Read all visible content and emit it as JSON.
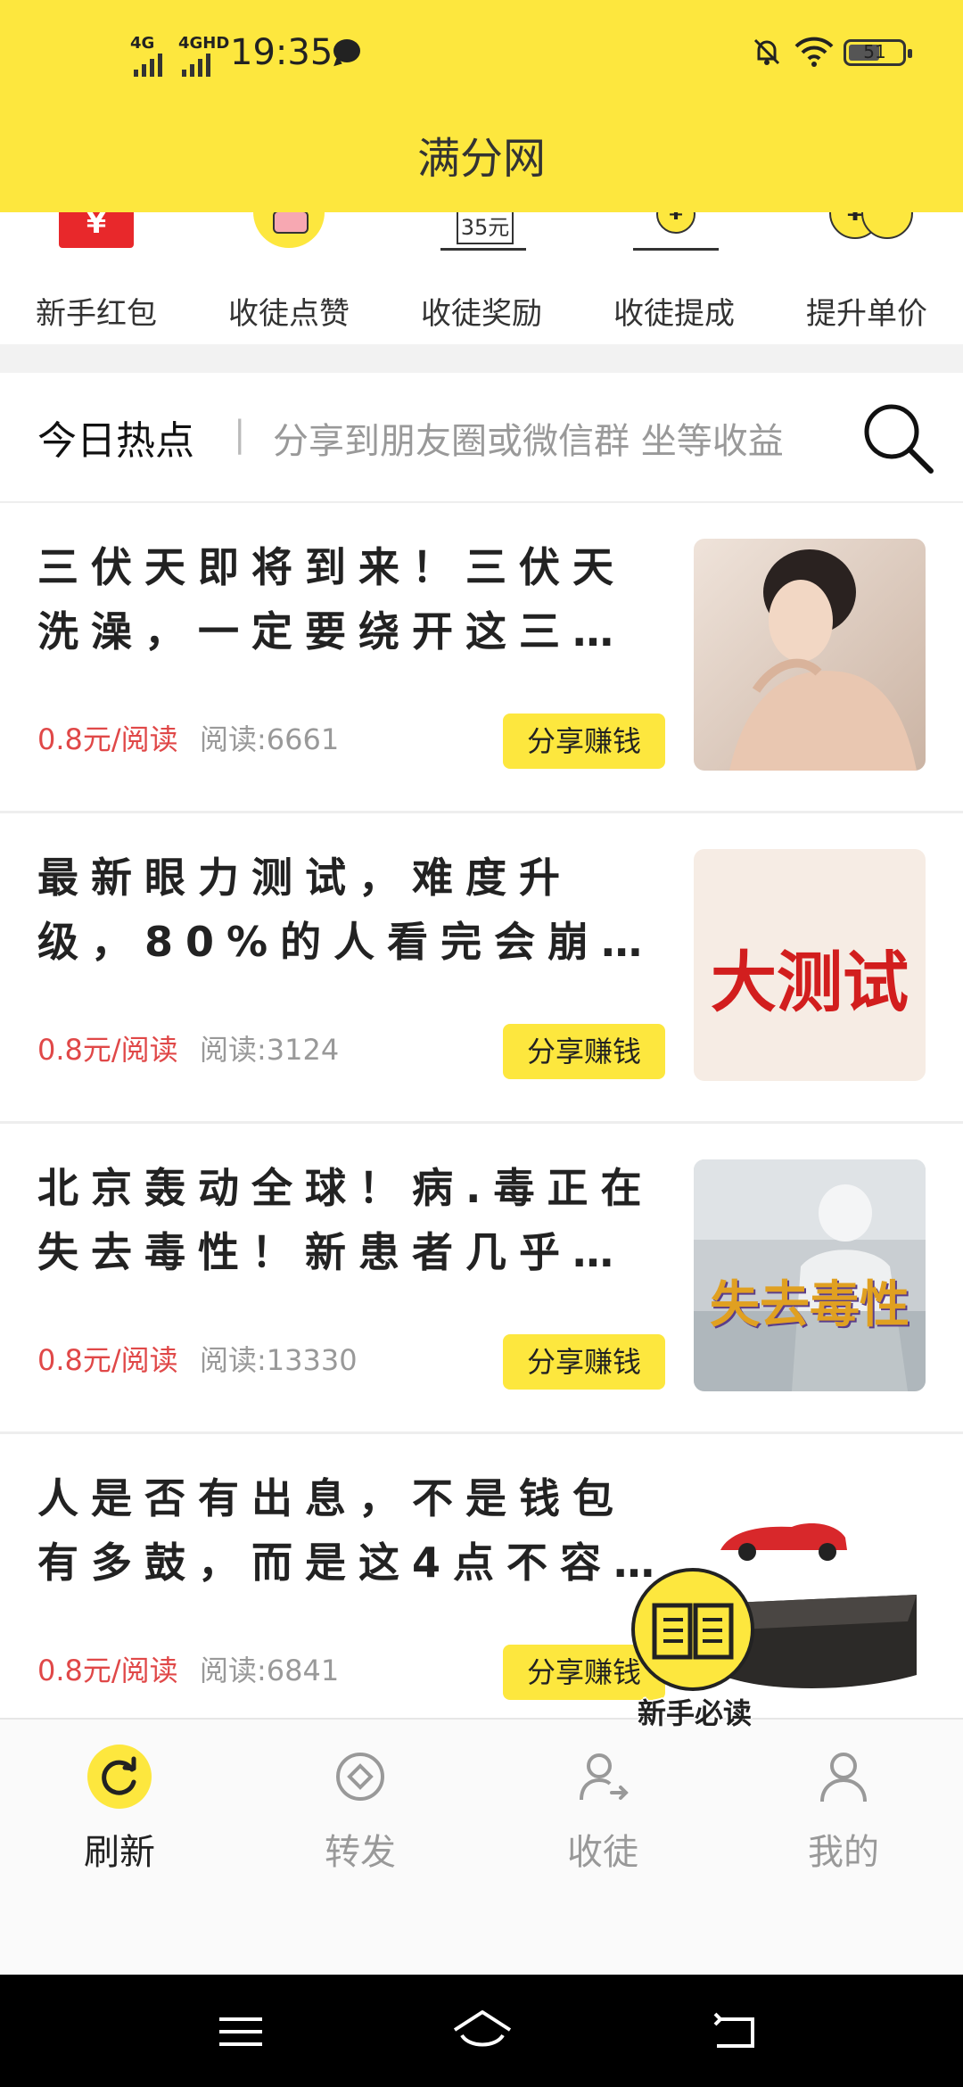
{
  "status_bar": {
    "network_1": "4G",
    "network_2": "4GHD",
    "time": "19:35",
    "battery": "51"
  },
  "header": {
    "title": "满分网"
  },
  "quick_entries": [
    {
      "label": "新手红包",
      "icon": "red-envelope-icon",
      "glyph": "¥"
    },
    {
      "label": "收徒点赞",
      "icon": "like-hand-icon"
    },
    {
      "label": "收徒奖励",
      "icon": "reward-board-icon",
      "glyph": "35元"
    },
    {
      "label": "收徒提成",
      "icon": "commission-coin-icon",
      "glyph": "¥"
    },
    {
      "label": "提升单价",
      "icon": "coins-up-icon",
      "glyph": "¥"
    }
  ],
  "hot": {
    "title": "今日热点",
    "separator": "|",
    "tip": "分享到朋友圈或微信群 坐等收益"
  },
  "articles": [
    {
      "title": "三伏天即将到来！三伏天\n洗澡，一定要绕开这三…",
      "price": "0.8元/阅读",
      "reads": "阅读:6661",
      "share": "分享赚钱",
      "thumb_text": ""
    },
    {
      "title": "最新眼力测试，难度升\n级，80%的人看完会崩…",
      "price": "0.8元/阅读",
      "reads": "阅读:3124",
      "share": "分享赚钱",
      "thumb_text": "大测试"
    },
    {
      "title": "北京轰动全球！病.毒正在\n失去毒性！新患者几乎…",
      "price": "0.8元/阅读",
      "reads": "阅读:13330",
      "share": "分享赚钱",
      "thumb_text": "失去毒性"
    },
    {
      "title": "人是否有出息，不是钱包\n有多鼓，而是这4点不容…",
      "price": "0.8元/阅读",
      "reads": "阅读:6841",
      "share": "分享赚钱",
      "thumb_text": ""
    }
  ],
  "guide": {
    "label": "新手必读",
    "icon": "book-icon"
  },
  "tabs": [
    {
      "label": "刷新",
      "icon": "refresh-icon",
      "active": true
    },
    {
      "label": "转发",
      "icon": "forward-icon",
      "active": false
    },
    {
      "label": "收徒",
      "icon": "add-follower-icon",
      "active": false
    },
    {
      "label": "我的",
      "icon": "profile-icon",
      "active": false
    }
  ],
  "colors": {
    "accent": "#FDE73E",
    "price": "#E04848",
    "muted": "#999999"
  }
}
